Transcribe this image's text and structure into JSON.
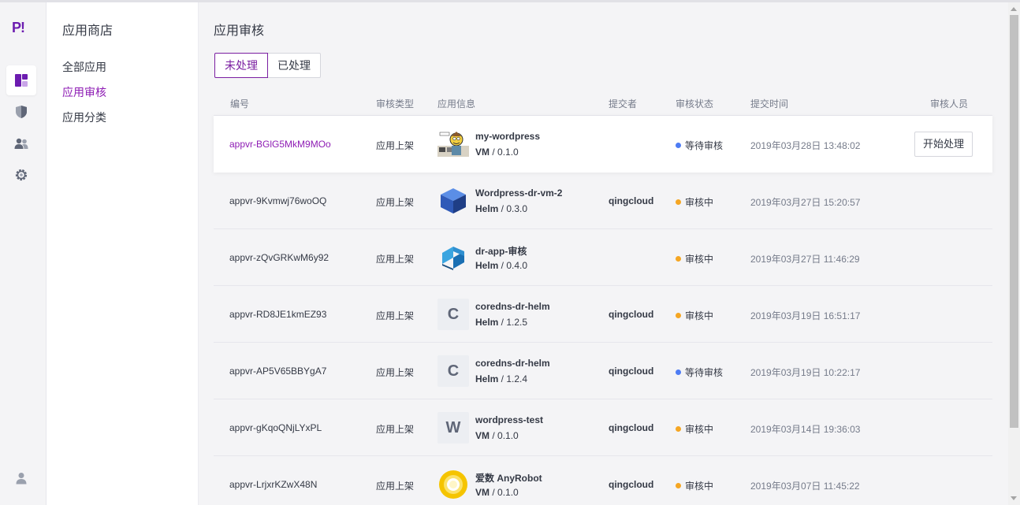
{
  "rail": {
    "logo_text": "P!",
    "items": [
      {
        "icon": "dashboard-icon",
        "active": true
      },
      {
        "icon": "shield-icon",
        "active": false
      },
      {
        "icon": "users-icon",
        "active": false
      },
      {
        "icon": "gear-icon",
        "active": false
      },
      {
        "icon": "user-icon",
        "active": false
      }
    ]
  },
  "subnav": {
    "title": "应用商店",
    "items": [
      {
        "label": "全部应用"
      },
      {
        "label": "应用审核",
        "active": true
      },
      {
        "label": "应用分类"
      }
    ]
  },
  "main": {
    "title": "应用审核",
    "tabs": [
      {
        "label": "未处理",
        "active": true
      },
      {
        "label": "已处理"
      }
    ],
    "columns": {
      "id": "编号",
      "type": "审核类型",
      "app": "应用信息",
      "submitter": "提交者",
      "status": "审核状态",
      "time": "提交时间",
      "reviewer": "审核人员"
    },
    "rows": [
      {
        "id": "appvr-BGlG5MkM9MOo",
        "type": "应用上架",
        "icon": "wordpress-character-image",
        "name": "my-wordpress",
        "kind": "VM",
        "version": "0.1.0",
        "submitter": "",
        "status": "等待审核",
        "status_color": "#4d7cf4",
        "time": "2019年03月28日 13:48:02",
        "action": "开始处理",
        "highlight": true
      },
      {
        "id": "appvr-9Kvmwj76woOQ",
        "type": "应用上架",
        "icon": "cube-icon",
        "name": "Wordpress-dr-vm-2",
        "kind": "Helm",
        "version": "0.3.0",
        "submitter": "qingcloud",
        "status": "审核中",
        "status_color": "#f5a623",
        "time": "2019年03月27日 15:20:57"
      },
      {
        "id": "appvr-zQvGRKwM6y92",
        "type": "应用上架",
        "icon": "helm-blocks-icon",
        "name": "dr-app-审核",
        "kind": "Helm",
        "version": "0.4.0",
        "submitter": "",
        "status": "审核中",
        "status_color": "#f5a623",
        "time": "2019年03月27日 11:46:29"
      },
      {
        "id": "appvr-RD8JE1kmEZ93",
        "type": "应用上架",
        "icon": "letter-icon",
        "letter": "C",
        "name": "coredns-dr-helm",
        "kind": "Helm",
        "version": "1.2.5",
        "submitter": "qingcloud",
        "status": "审核中",
        "status_color": "#f5a623",
        "time": "2019年03月19日 16:51:17"
      },
      {
        "id": "appvr-AP5V65BBYgA7",
        "type": "应用上架",
        "icon": "letter-icon",
        "letter": "C",
        "name": "coredns-dr-helm",
        "kind": "Helm",
        "version": "1.2.4",
        "submitter": "qingcloud",
        "status": "等待审核",
        "status_color": "#4d7cf4",
        "time": "2019年03月19日 10:22:17"
      },
      {
        "id": "appvr-gKqoQNjLYxPL",
        "type": "应用上架",
        "icon": "letter-icon",
        "letter": "W",
        "name": "wordpress-test",
        "kind": "VM",
        "version": "0.1.0",
        "submitter": "qingcloud",
        "status": "审核中",
        "status_color": "#f5a623",
        "time": "2019年03月14日 19:36:03"
      },
      {
        "id": "appvr-LrjxrKZwX48N",
        "type": "应用上架",
        "icon": "ring-logo-icon",
        "name": "爱数 AnyRobot",
        "kind": "VM",
        "version": "0.1.0",
        "submitter": "qingcloud",
        "status": "审核中",
        "status_color": "#f5a623",
        "time": "2019年03月07日 11:45:22"
      }
    ]
  }
}
